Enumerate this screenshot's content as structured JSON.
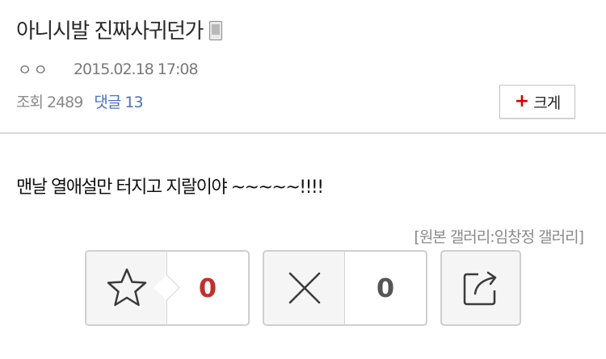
{
  "post": {
    "title": "아니시발 진짜사귀던가",
    "author": "ㅇㅇ",
    "datetime": "2015.02.18 17:08",
    "views": "조회 2489",
    "comments": "댓글 13",
    "body": "맨날 열애설만 터지고 지랄이야 ~~~~~!!!!",
    "source": "[원본 갤러리:임창정 갤러리]"
  },
  "font_button": {
    "icon": "+",
    "label": "크게"
  },
  "recommend": {
    "count": "0",
    "color": "#c0312b"
  },
  "unrecommend": {
    "count": "0",
    "color": "#555555"
  },
  "icons": [
    "mobile-icon",
    "plus-icon",
    "star-icon",
    "x-icon",
    "share-icon"
  ]
}
